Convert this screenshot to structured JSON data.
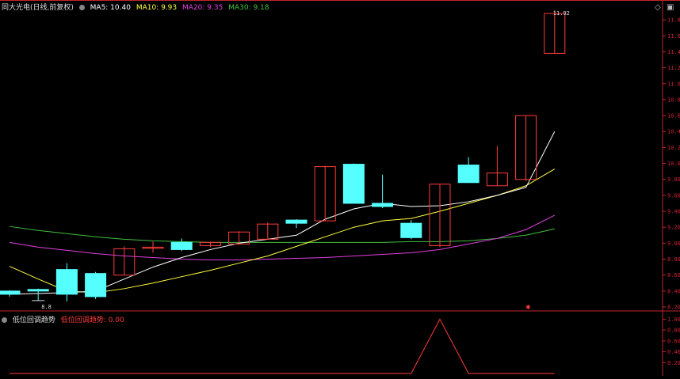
{
  "legend": {
    "stock_name": "同大光电(日线,前复权)",
    "ma5": "MA5: 10.40",
    "ma10": "MA10: 9.93",
    "ma20": "MA20: 9.35",
    "ma30": "MA30: 9.18"
  },
  "indicator": {
    "name": "低位回调趋势",
    "value_label": "低位回调趋势: 0.00"
  },
  "price_axis": [
    "11.80",
    "11.60",
    "11.40",
    "11.20",
    "11.00",
    "10.80",
    "10.60",
    "10.40",
    "10.20",
    "10.00",
    "9.80",
    "9.60",
    "9.40",
    "9.20",
    "9.00",
    "8.80",
    "8.60",
    "8.40",
    "8.20"
  ],
  "indicator_axis": [
    "1.00",
    "0.80",
    "0.60",
    "0.40",
    "0.20"
  ],
  "low_marker": "8.8",
  "high_marker": "11.92",
  "icons": {
    "diamond": "diamond-icon",
    "panel": "panel-toggle-icon"
  },
  "colors": {
    "up": "#ff3b3b",
    "down": "#5ff",
    "ma5": "#ffffff",
    "ma10": "#ffff40",
    "ma20": "#e040e0",
    "ma30": "#40c040",
    "axis": "#c0262c"
  },
  "chart_data": {
    "type": "candlestick",
    "candles": [
      {
        "o": 8.4,
        "c": 8.36,
        "h": 8.41,
        "l": 8.33
      },
      {
        "o": 8.42,
        "c": 8.4,
        "h": 8.43,
        "l": 8.28
      },
      {
        "o": 8.67,
        "c": 8.36,
        "h": 8.75,
        "l": 8.27
      },
      {
        "o": 8.62,
        "c": 8.33,
        "h": 8.64,
        "l": 8.3
      },
      {
        "o": 8.6,
        "c": 8.93,
        "h": 8.96,
        "l": 8.6
      },
      {
        "o": 8.94,
        "c": 8.95,
        "h": 9.02,
        "l": 8.88
      },
      {
        "o": 9.01,
        "c": 8.92,
        "h": 9.06,
        "l": 8.9
      },
      {
        "o": 8.97,
        "c": 9.01,
        "h": 9.02,
        "l": 8.95
      },
      {
        "o": 8.99,
        "c": 9.14,
        "h": 9.15,
        "l": 8.98
      },
      {
        "o": 9.05,
        "c": 9.24,
        "h": 9.26,
        "l": 9.05
      },
      {
        "o": 9.29,
        "c": 9.25,
        "h": 9.3,
        "l": 9.19
      },
      {
        "o": 9.28,
        "c": 9.96,
        "h": 9.97,
        "l": 9.28
      },
      {
        "o": 9.99,
        "c": 9.5,
        "h": 10.0,
        "l": 9.5
      },
      {
        "o": 9.5,
        "c": 9.46,
        "h": 9.86,
        "l": 9.44
      },
      {
        "o": 9.25,
        "c": 9.07,
        "h": 9.29,
        "l": 9.05
      },
      {
        "o": 8.97,
        "c": 9.74,
        "h": 9.74,
        "l": 8.95
      },
      {
        "o": 9.98,
        "c": 9.76,
        "h": 10.08,
        "l": 9.76
      },
      {
        "o": 9.72,
        "c": 9.88,
        "h": 10.22,
        "l": 9.72
      },
      {
        "o": 9.8,
        "c": 10.6,
        "h": 10.6,
        "l": 9.78
      },
      {
        "o": 11.38,
        "c": 11.88,
        "h": 11.92,
        "l": 11.38
      }
    ],
    "ma5": [
      8.36,
      8.37,
      8.38,
      8.4,
      8.55,
      8.7,
      8.82,
      8.92,
      9.0,
      9.05,
      9.1,
      9.3,
      9.43,
      9.5,
      9.46,
      9.47,
      9.52,
      9.6,
      9.7,
      10.4
    ],
    "ma10": [
      8.71,
      8.55,
      8.4,
      8.38,
      8.43,
      8.5,
      8.58,
      8.66,
      8.75,
      8.84,
      8.96,
      9.08,
      9.2,
      9.28,
      9.31,
      9.4,
      9.5,
      9.6,
      9.72,
      9.93
    ],
    "ma20": [
      9.01,
      8.95,
      8.91,
      8.87,
      8.84,
      8.82,
      8.8,
      8.79,
      8.79,
      8.8,
      8.81,
      8.82,
      8.84,
      8.86,
      8.88,
      8.92,
      8.99,
      9.06,
      9.17,
      9.35
    ],
    "ma30": [
      9.21,
      9.16,
      9.12,
      9.08,
      9.05,
      9.03,
      9.02,
      9.01,
      9.01,
      9.01,
      9.01,
      9.01,
      9.01,
      9.01,
      9.02,
      9.02,
      9.03,
      9.06,
      9.1,
      9.18
    ],
    "indicator": [
      0,
      0,
      0,
      0,
      0,
      0,
      0,
      0,
      0,
      0,
      0,
      0,
      0,
      0,
      0,
      1,
      0,
      0,
      0,
      0
    ],
    "ylim": [
      8.2,
      11.95
    ],
    "indicator_ylim": [
      0,
      1.05
    ]
  }
}
